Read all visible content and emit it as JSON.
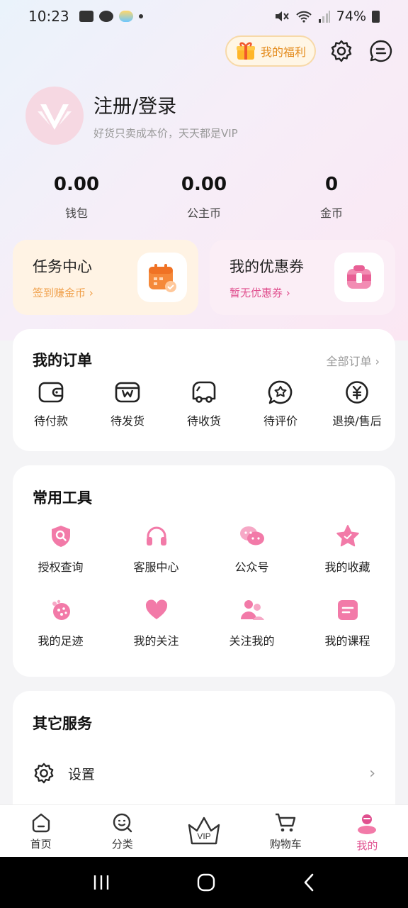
{
  "status_bar": {
    "time": "10:23",
    "battery": "74%"
  },
  "header": {
    "welfare_label": "我的福利"
  },
  "profile": {
    "title": "注册/登录",
    "subtitle": "好货只卖成本价，天天都是VIP"
  },
  "stats": [
    {
      "value": "0.00",
      "label": "钱包"
    },
    {
      "value": "0.00",
      "label": "公主币"
    },
    {
      "value": "0",
      "label": "金币"
    }
  ],
  "promos": {
    "task": {
      "title": "任务中心",
      "sub": "签到赚金币"
    },
    "coupon": {
      "title": "我的优惠券",
      "sub": "暂无优惠券"
    }
  },
  "orders": {
    "title": "我的订单",
    "more": "全部订单",
    "items": [
      {
        "label": "待付款",
        "icon": "wallet-icon"
      },
      {
        "label": "待发货",
        "icon": "package-icon"
      },
      {
        "label": "待收货",
        "icon": "truck-icon"
      },
      {
        "label": "待评价",
        "icon": "review-icon"
      },
      {
        "label": "退换/售后",
        "icon": "refund-icon"
      }
    ]
  },
  "tools": {
    "title": "常用工具",
    "items": [
      {
        "label": "授权查询",
        "icon": "shield-search-icon"
      },
      {
        "label": "客服中心",
        "icon": "headphones-icon"
      },
      {
        "label": "公众号",
        "icon": "wechat-icon"
      },
      {
        "label": "我的收藏",
        "icon": "star-icon"
      },
      {
        "label": "我的足迹",
        "icon": "footprint-icon"
      },
      {
        "label": "我的关注",
        "icon": "heart-icon"
      },
      {
        "label": "关注我的",
        "icon": "people-icon"
      },
      {
        "label": "我的课程",
        "icon": "course-icon"
      }
    ]
  },
  "services": {
    "title": "其它服务",
    "items": [
      {
        "label": "设置",
        "icon": "gear-icon"
      }
    ]
  },
  "tabbar": {
    "items": [
      {
        "label": "首页",
        "icon": "home-icon"
      },
      {
        "label": "分类",
        "icon": "category-icon"
      },
      {
        "label": "",
        "icon": "vip-crown-icon"
      },
      {
        "label": "购物车",
        "icon": "cart-icon"
      },
      {
        "label": "我的",
        "icon": "profile-icon"
      }
    ]
  },
  "colors": {
    "accent": "#e0508f",
    "orange": "#f0a04b"
  }
}
